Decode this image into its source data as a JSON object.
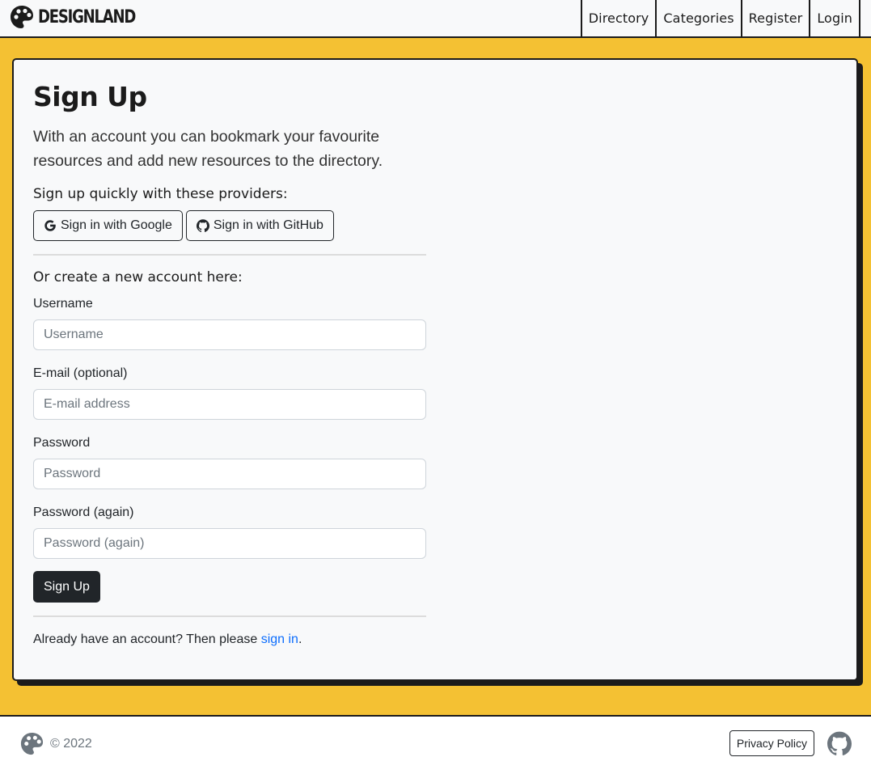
{
  "header": {
    "brand": "DESIGNLAND",
    "nav": [
      {
        "label": "Directory"
      },
      {
        "label": "Categories"
      },
      {
        "label": "Register"
      },
      {
        "label": "Login"
      }
    ]
  },
  "page": {
    "title": "Sign Up",
    "lead": "With an account you can bookmark your favourite resources and add new resources to the directory.",
    "providers_heading": "Sign up quickly with these providers:",
    "providers": [
      {
        "label": "Sign in with Google",
        "icon": "google-icon"
      },
      {
        "label": "Sign in with GitHub",
        "icon": "github-icon"
      }
    ],
    "form_heading": "Or create a new account here:",
    "fields": {
      "username": {
        "label": "Username",
        "placeholder": "Username",
        "value": ""
      },
      "email": {
        "label": "E-mail (optional)",
        "placeholder": "E-mail address",
        "value": ""
      },
      "password": {
        "label": "Password",
        "placeholder": "Password",
        "value": ""
      },
      "password2": {
        "label": "Password (again)",
        "placeholder": "Password (again)",
        "value": ""
      }
    },
    "submit_label": "Sign Up",
    "signin_prefix": "Already have an account? Then please ",
    "signin_link": "sign in",
    "signin_suffix": "."
  },
  "footer": {
    "copyright": "© 2022",
    "privacy_label": "Privacy Policy"
  },
  "colors": {
    "accent": "#f4c133",
    "dark": "#1b1b1b",
    "link": "#0d6efd"
  }
}
